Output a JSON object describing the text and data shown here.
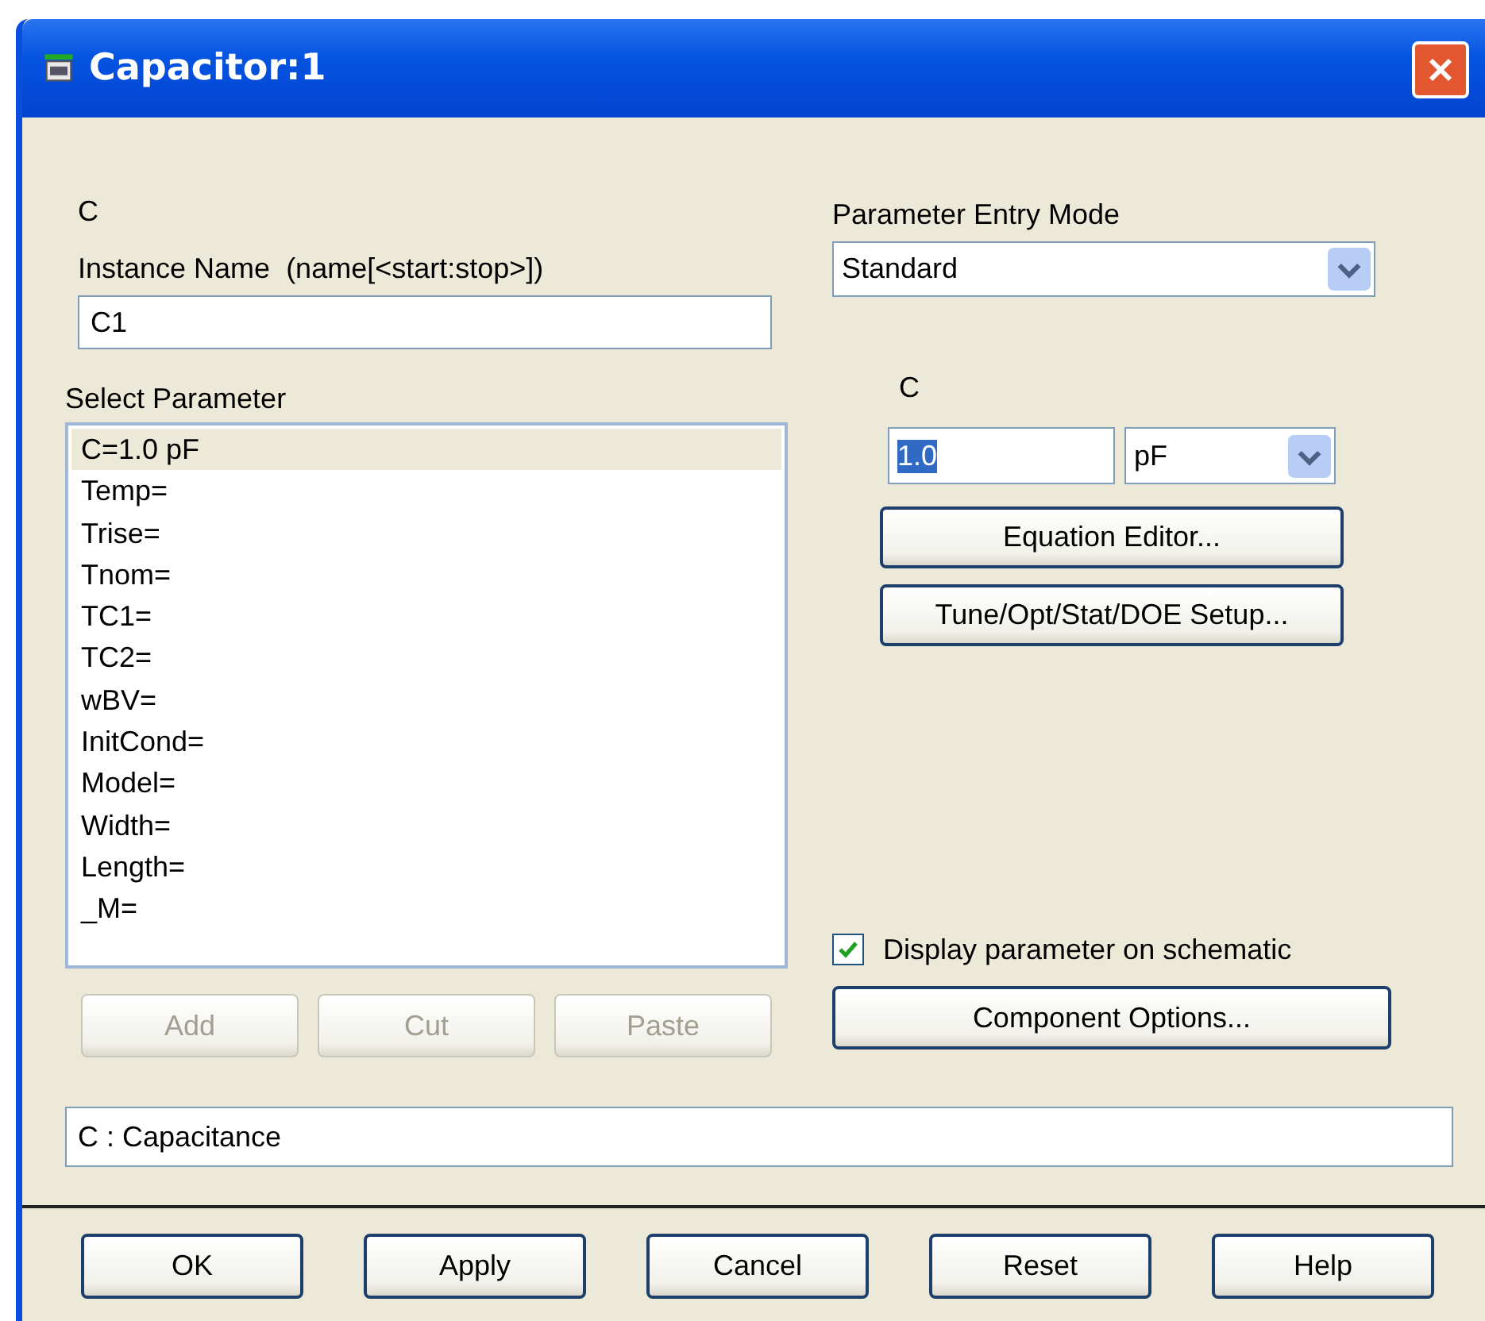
{
  "window": {
    "title": "Capacitor:1"
  },
  "component_label": "C",
  "instance_name": {
    "label": "Instance Name  (name[<start:stop>])",
    "value": "C1"
  },
  "select_parameter": {
    "label": "Select Parameter",
    "items": [
      {
        "text": "C=1.0 pF",
        "selected": true
      },
      {
        "text": "Temp=",
        "selected": false
      },
      {
        "text": "Trise=",
        "selected": false
      },
      {
        "text": "Tnom=",
        "selected": false
      },
      {
        "text": "TC1=",
        "selected": false
      },
      {
        "text": "TC2=",
        "selected": false
      },
      {
        "text": "wBV=",
        "selected": false
      },
      {
        "text": "InitCond=",
        "selected": false
      },
      {
        "text": "Model=",
        "selected": false
      },
      {
        "text": "Width=",
        "selected": false
      },
      {
        "text": "Length=",
        "selected": false
      },
      {
        "text": "_M=",
        "selected": false
      }
    ]
  },
  "list_buttons": [
    {
      "label": "Add",
      "disabled": true
    },
    {
      "label": "Cut",
      "disabled": true
    },
    {
      "label": "Paste",
      "disabled": true
    }
  ],
  "entry_mode": {
    "label": "Parameter Entry Mode",
    "value": "Standard"
  },
  "parameter": {
    "label": "C",
    "value": "1.0",
    "value_selected": true,
    "unit": "pF"
  },
  "parameter_buttons": [
    "Equation Editor...",
    "Tune/Opt/Stat/DOE Setup..."
  ],
  "display_on_schematic": {
    "label": "Display parameter on schematic",
    "checked": true
  },
  "component_options": "Component Options...",
  "description": "C : Capacitance",
  "buttons": [
    "OK",
    "Apply",
    "Cancel",
    "Reset",
    "Help"
  ]
}
